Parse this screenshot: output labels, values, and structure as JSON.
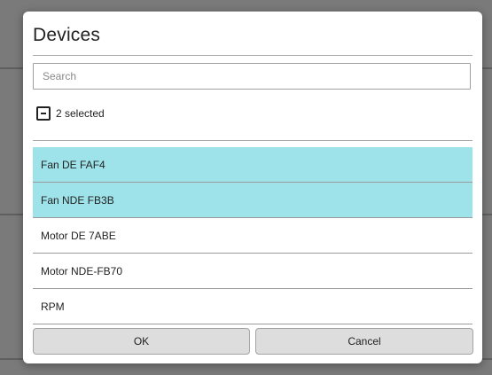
{
  "dialog": {
    "title": "Devices",
    "search": {
      "placeholder": "Search",
      "value": ""
    },
    "selection": {
      "summary": "2 selected",
      "state": "indeterminate"
    },
    "items": [
      {
        "label": "Fan DE FAF4",
        "selected": true
      },
      {
        "label": "Fan NDE FB3B",
        "selected": true
      },
      {
        "label": "Motor DE 7ABE",
        "selected": false
      },
      {
        "label": "Motor NDE-FB70",
        "selected": false
      },
      {
        "label": "RPM",
        "selected": false
      }
    ],
    "buttons": {
      "ok": "OK",
      "cancel": "Cancel"
    },
    "colors": {
      "selected_row": "#9ee3ea",
      "button_bg": "#dddddd"
    }
  }
}
